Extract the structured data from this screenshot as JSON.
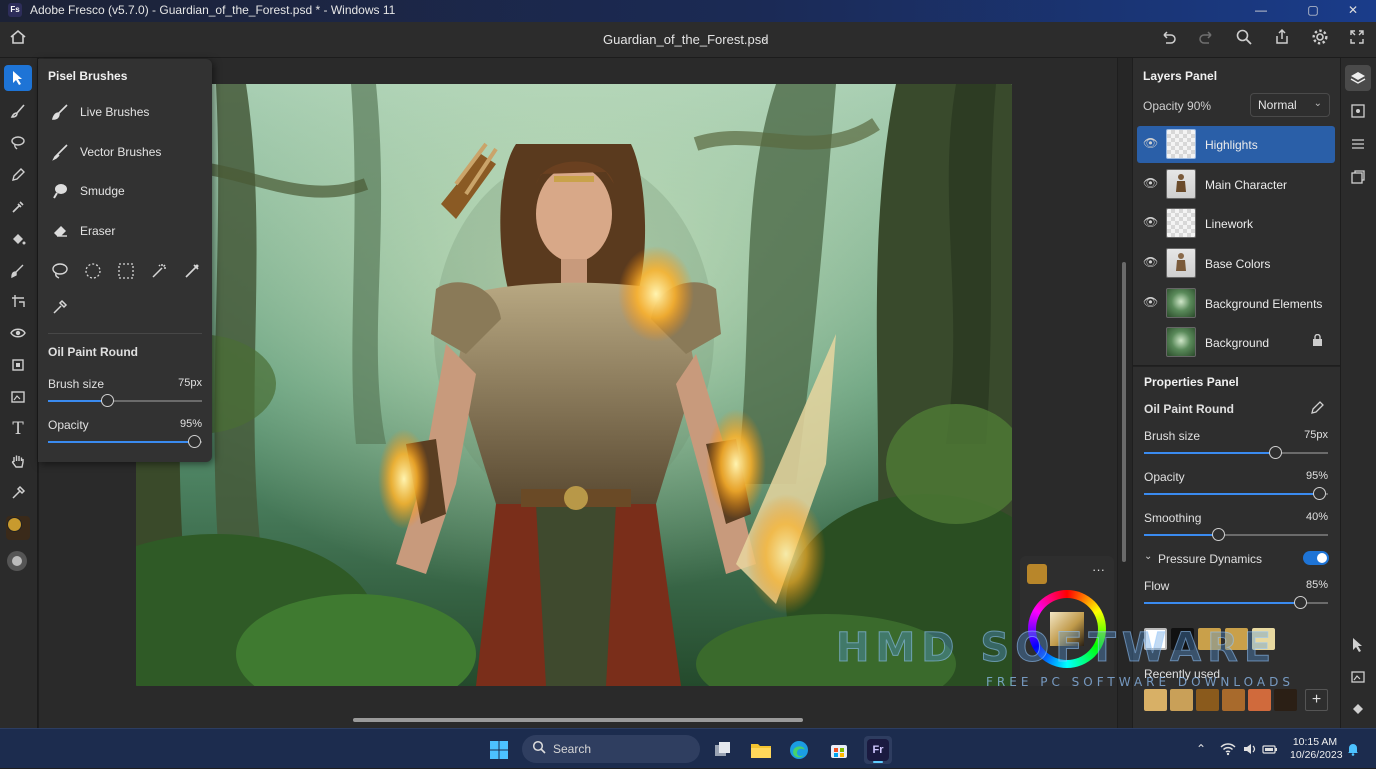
{
  "window": {
    "app_icon_label": "Fs",
    "title": "Adobe Fresco (v5.7.0) - Guardian_of_the_Forest.psd * - Windows 11",
    "controls": {
      "minimize": "—",
      "maximize": "▢",
      "close": "✕"
    }
  },
  "header": {
    "home_icon": "home-icon",
    "doc_name": "Guardian_of_the_Forest.psd",
    "doc_chevron": "⌄",
    "actions": [
      "undo-icon",
      "redo-icon",
      "search-icon",
      "share-icon",
      "settings-icon",
      "fullscreen-icon"
    ]
  },
  "toolbar": {
    "tools": [
      "select-icon",
      "paint-brush-icon",
      "lasso-icon",
      "pen-icon",
      "eyedropper-icon",
      "fill-icon",
      "smudge-icon",
      "transform-icon",
      "visibility-icon",
      "crop-icon",
      "place-image-icon",
      "text-icon",
      "hand-icon",
      "color-picker-icon",
      "color-swatch-icon",
      "circle-icon"
    ]
  },
  "brush_panel": {
    "title": "Pisel Brushes",
    "items": [
      {
        "label": "Live Brushes",
        "icon": "live-brush-icon"
      },
      {
        "label": "Vector Brushes",
        "icon": "vector-brush-icon"
      },
      {
        "label": "Smudge",
        "icon": "smudge-icon"
      },
      {
        "label": "Eraser",
        "icon": "eraser-icon"
      }
    ],
    "selection_tools": [
      "lasso-select-icon",
      "ellipse-select-icon",
      "rect-select-icon",
      "magic-wand-icon",
      "wand-icon",
      "eyedropper-icon"
    ],
    "brush_name": "Oil Paint Round",
    "brush_size_label": "Brush size",
    "brush_size_value": "75px",
    "brush_size_fraction": 0.38,
    "opacity_label": "Opacity",
    "opacity_value": "95%",
    "opacity_fraction": 0.95
  },
  "layers_panel": {
    "title": "Layers Panel",
    "opacity_label": "Opacity 90%",
    "blend_mode": "Normal",
    "layers": [
      {
        "name": "Highlights",
        "selected": true,
        "visible": true,
        "locked": false
      },
      {
        "name": "Main Character",
        "selected": false,
        "visible": true,
        "locked": false
      },
      {
        "name": "Linework",
        "selected": false,
        "visible": true,
        "locked": false
      },
      {
        "name": "Base Colors",
        "selected": false,
        "visible": true,
        "locked": false
      },
      {
        "name": "Background Elements",
        "selected": false,
        "visible": true,
        "locked": false
      },
      {
        "name": "Background",
        "selected": false,
        "visible": false,
        "locked": true
      }
    ]
  },
  "properties_panel": {
    "title": "Properties Panel",
    "brush_name": "Oil Paint Round",
    "brush_size_label": "Brush size",
    "brush_size_value": "75px",
    "brush_size_fraction": 0.71,
    "opacity_label": "Opacity",
    "opacity_value": "95%",
    "opacity_fraction": 0.95,
    "smoothing_label": "Smoothing",
    "smoothing_value": "40%",
    "smoothing_fraction": 0.4,
    "pressure_label": "Pressure Dynamics",
    "pressure_on": true,
    "flow_label": "Flow",
    "flow_value": "85%",
    "flow_fraction": 0.85,
    "recently_used_label": "Recently used",
    "add_label": "+",
    "top_swatches": [
      "#ffffff",
      "#111111",
      "#c9a04a",
      "#c9a04a",
      "#e8d9a0"
    ],
    "recent_swatches": [
      "#d8b066",
      "#c9a058",
      "#8a5a1c",
      "#a86a2c",
      "#d06a3c",
      "#2b1f15"
    ]
  },
  "color_puck": {
    "current_color": "#b8862a",
    "more_label": "···"
  },
  "watermark": {
    "brand": "HMD SOFTWARE",
    "tagline": "FREE PC SOFTWARE DOWNLOADS"
  },
  "taskbar": {
    "search_label": "Search",
    "apps": [
      "windows-start-icon",
      "task-view-icon",
      "file-explorer-icon",
      "edge-icon",
      "store-icon",
      "fresco-icon"
    ],
    "fresco_label": "Fr",
    "time": "10:15 AM",
    "date": "10/26/2023"
  },
  "colors": {
    "accent": "#1e74d6",
    "panel": "#2e2e2e",
    "selected_layer": "#2a5fa8"
  }
}
